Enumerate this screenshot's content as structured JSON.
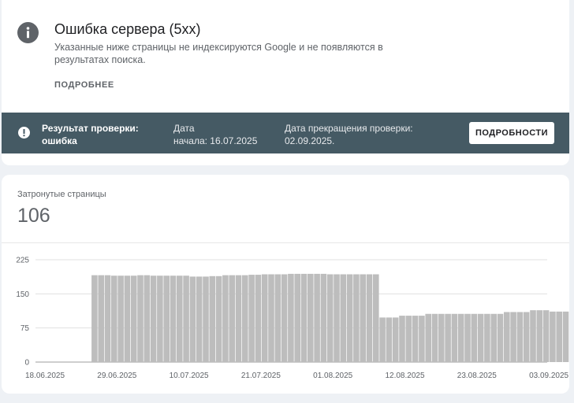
{
  "issue": {
    "title": "Ошибка сервера (5xx)",
    "description": "Указанные ниже страницы не индексируются Google и не появляются в результатах поиска.",
    "more_link": "ПОДРОБНЕЕ"
  },
  "validation": {
    "result_line1": "Результат проверки:",
    "result_line2": "ошибка",
    "start_line1": "Дата",
    "start_line2": "начала: 16.07.2025",
    "end_line1": "Дата прекращения проверки:",
    "end_line2": "02.09.2025.",
    "details_button": "ПОДРОБНОСТИ"
  },
  "affected": {
    "label": "Затронутые страницы",
    "count": "106"
  },
  "colors": {
    "banner": "#455a64",
    "bar": "#bdbdbd",
    "icon": "#5f6368"
  },
  "chart_data": {
    "type": "bar",
    "title": "",
    "xlabel": "",
    "ylabel": "",
    "ylim": [
      0,
      225
    ],
    "y_ticks": [
      "225",
      "150",
      "75",
      "0"
    ],
    "y_tick_values": [
      225,
      150,
      75,
      0
    ],
    "x_tick_labels": [
      "18.06.2025",
      "29.06.2025",
      "10.07.2025",
      "21.07.2025",
      "01.08.2025",
      "12.08.2025",
      "23.08.2025",
      "03.09.2025"
    ],
    "x_tick_index": [
      0,
      11,
      22,
      33,
      44,
      55,
      66,
      77
    ],
    "grid": true,
    "values": [
      0,
      0,
      0,
      0,
      0,
      0,
      0,
      191,
      191,
      191,
      190,
      190,
      190,
      190,
      191,
      191,
      190,
      190,
      190,
      190,
      190,
      190,
      188,
      188,
      188,
      189,
      189,
      191,
      191,
      191,
      191,
      192,
      192,
      193,
      193,
      193,
      193,
      194,
      194,
      194,
      194,
      194,
      194,
      193,
      193,
      193,
      193,
      193,
      193,
      193,
      193,
      98,
      98,
      98,
      102,
      102,
      102,
      102,
      106,
      106,
      106,
      106,
      106,
      106,
      106,
      106,
      106,
      106,
      106,
      106,
      110,
      110,
      110,
      110,
      114,
      114,
      114,
      111,
      111,
      111,
      111,
      107,
      107,
      107,
      107,
      107,
      107,
      107
    ]
  }
}
